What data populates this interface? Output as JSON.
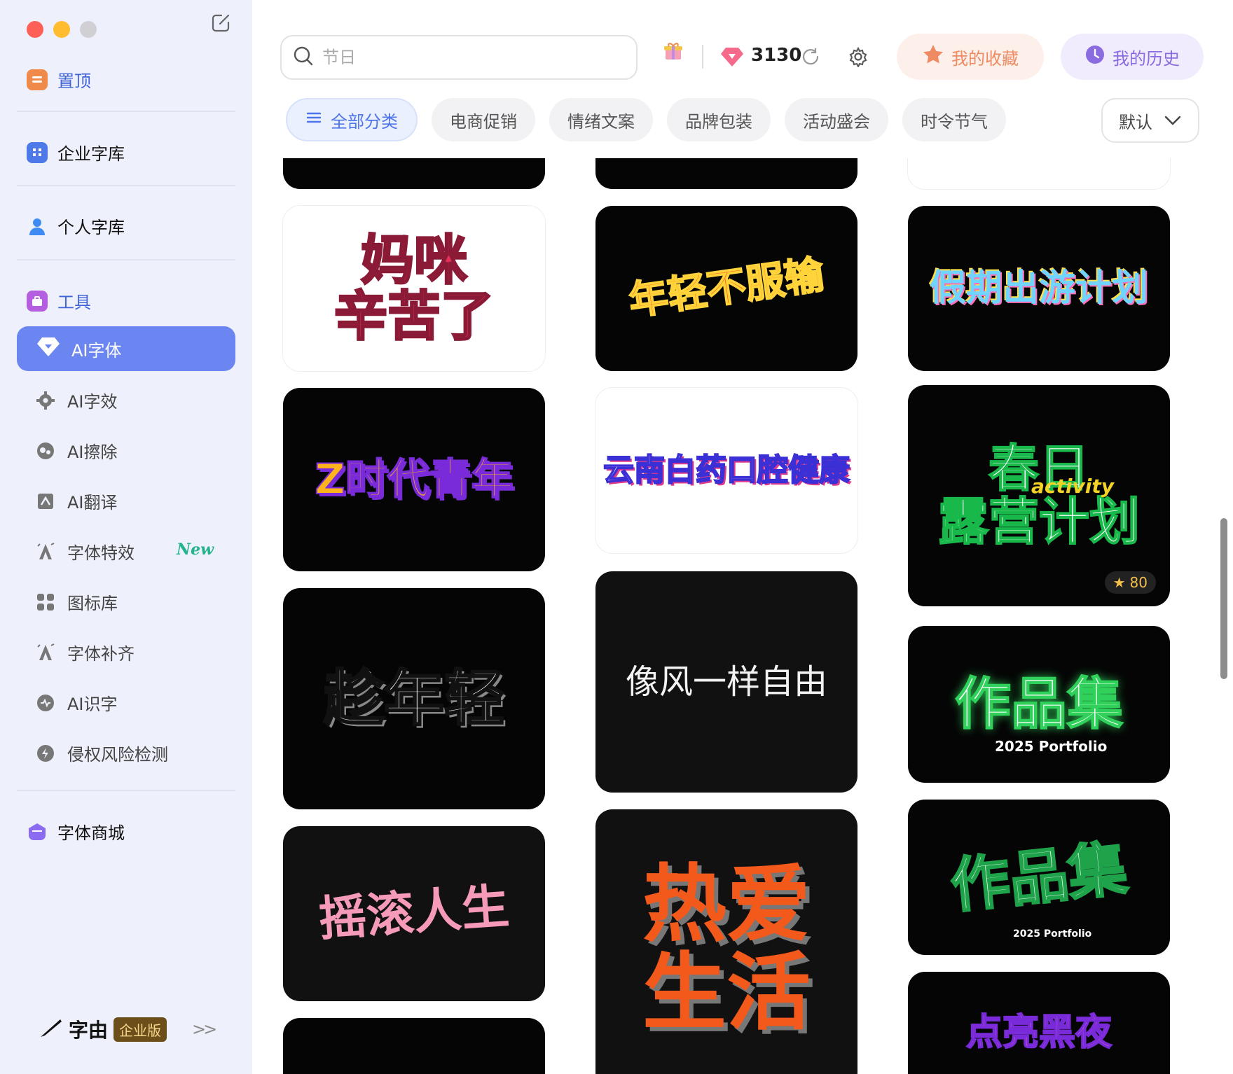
{
  "sidebar": {
    "pinned_label": "置顶",
    "enterprise_label": "企业字库",
    "personal_label": "个人字库",
    "tools_label": "工具",
    "tools": [
      {
        "label": "AI字体",
        "icon": "diamond-icon",
        "active": true
      },
      {
        "label": "AI字效",
        "icon": "magic-gear-icon"
      },
      {
        "label": "AI擦除",
        "icon": "eraser-icon"
      },
      {
        "label": "AI翻译",
        "icon": "translate-icon"
      },
      {
        "label": "字体特效",
        "icon": "font-effect-icon",
        "badge": "New"
      },
      {
        "label": "图标库",
        "icon": "grid-icon"
      },
      {
        "label": "字体补齐",
        "icon": "font-complete-icon"
      },
      {
        "label": "AI识字",
        "icon": "recognize-icon"
      },
      {
        "label": "侵权风险检测",
        "icon": "lightning-icon"
      }
    ],
    "store_label": "字体商城",
    "brand_name": "字由",
    "brand_badge": "企业版",
    "collapse_glyph": ">>"
  },
  "topbar": {
    "search_placeholder": "节日",
    "points": "3130",
    "favorites_label": "我的收藏",
    "history_label": "我的历史"
  },
  "categories": [
    "全部分类",
    "电商促销",
    "情绪文案",
    "品牌包装",
    "活动盛会",
    "时令节气"
  ],
  "sort_label": "默认",
  "cards": [
    {
      "text": "妈咪\n辛苦了",
      "theme": "light"
    },
    {
      "text": "年轻不服输",
      "theme": "dark"
    },
    {
      "text": "假期出游计划",
      "theme": "dark"
    },
    {
      "text": "Z时代青年",
      "theme": "dark"
    },
    {
      "text": "云南白药口腔健康",
      "theme": "light"
    },
    {
      "text": "春日\n露营计划",
      "theme": "dark",
      "sub": "activity",
      "favorites": "80"
    },
    {
      "text": "趁年轻",
      "theme": "dark"
    },
    {
      "text": "像风一样自由",
      "theme": "dark"
    },
    {
      "text": "作品集",
      "theme": "dark",
      "sub": "2025 Portfolio"
    },
    {
      "text": "摇滚人生",
      "theme": "dark"
    },
    {
      "text": "热爱\n生活",
      "theme": "dark"
    },
    {
      "text": "作品集",
      "theme": "dark",
      "sub": "2025 Portfolio"
    },
    {
      "text": "点亮黑夜",
      "theme": "dark"
    }
  ],
  "colors": {
    "accent": "#6b86f0",
    "favorite": "#ef8a63",
    "history": "#8a6be0"
  }
}
